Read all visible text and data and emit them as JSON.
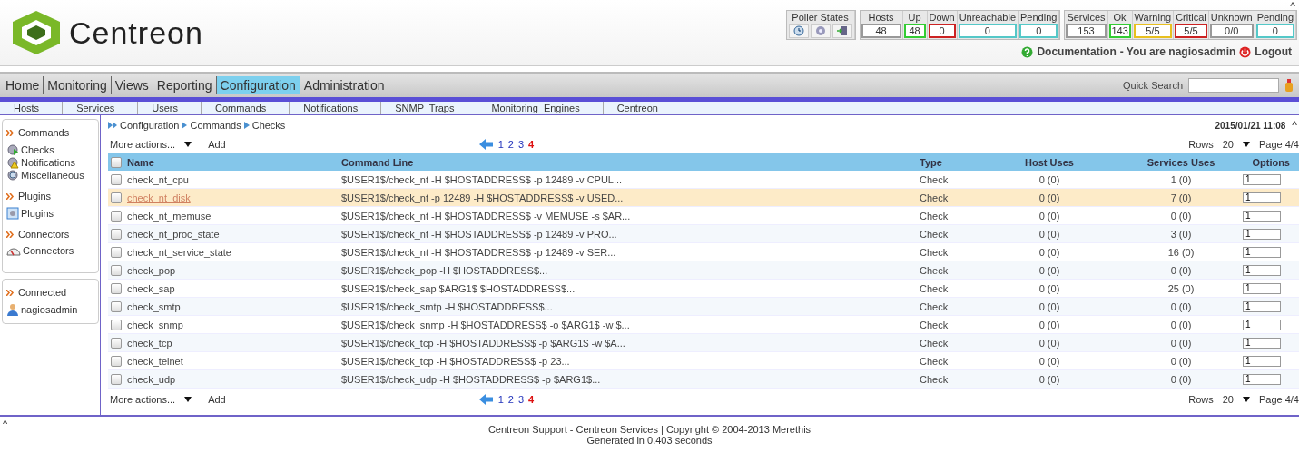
{
  "logo": {
    "text": "Centreon"
  },
  "header_caret": "^",
  "poller": {
    "title": "Poller States"
  },
  "hosts_stats": [
    {
      "label": "Hosts",
      "value": "48",
      "color": "#999999"
    },
    {
      "label": "Up",
      "value": "48",
      "color": "#33cc33"
    },
    {
      "label": "Down",
      "value": "0",
      "color": "#cc2222"
    },
    {
      "label": "Unreachable",
      "value": "0",
      "color": "#55c8c8"
    },
    {
      "label": "Pending",
      "value": "0",
      "color": "#55c8c8"
    }
  ],
  "services_stats": [
    {
      "label": "Services",
      "value": "153",
      "color": "#999999"
    },
    {
      "label": "Ok",
      "value": "143",
      "color": "#33cc33"
    },
    {
      "label": "Warning",
      "value": "5/5",
      "color": "#e8c020"
    },
    {
      "label": "Critical",
      "value": "5/5",
      "color": "#cc2222"
    },
    {
      "label": "Unknown",
      "value": "0/0",
      "color": "#999999"
    },
    {
      "label": "Pending",
      "value": "0",
      "color": "#55c8c8"
    }
  ],
  "user_bar": {
    "documentation": "Documentation",
    "user_text": "- You are nagiosadmin",
    "logout": "Logout"
  },
  "menu": [
    {
      "label": "Home",
      "selected": false
    },
    {
      "label": "Monitoring",
      "selected": false
    },
    {
      "label": "Views",
      "selected": false
    },
    {
      "label": "Reporting",
      "selected": false
    },
    {
      "label": "Configuration",
      "selected": true
    },
    {
      "label": "Administration",
      "selected": false
    }
  ],
  "quick_search": {
    "label": "Quick Search"
  },
  "submenu": [
    "Hosts",
    "Services",
    "Users",
    "Commands",
    "Notifications",
    "SNMP  Traps",
    "Monitoring  Engines",
    "Centreon"
  ],
  "sidebar": [
    {
      "title": "Commands",
      "items": [
        {
          "label": "Checks",
          "kind": "checks"
        },
        {
          "label": "Notifications",
          "kind": "notifications"
        },
        {
          "label": "Miscellaneous",
          "kind": "misc"
        }
      ]
    },
    {
      "title": "Plugins",
      "items": [
        {
          "label": "Plugins",
          "kind": "plugins"
        }
      ]
    },
    {
      "title": "Connectors",
      "items": [
        {
          "label": "Connectors",
          "kind": "connectors"
        }
      ]
    }
  ],
  "connected": {
    "title": "Connected",
    "user": "nagiosadmin"
  },
  "breadcrumb": [
    "Configuration",
    "Commands",
    "Checks"
  ],
  "datetime": "2015/01/21 11:08",
  "content_caret": "^",
  "toolbars": [
    {
      "more_actions": "More actions...",
      "add": "Add",
      "pages": [
        {
          "label": "1",
          "selected": false
        },
        {
          "label": "2",
          "selected": false
        },
        {
          "label": "3",
          "selected": false
        },
        {
          "label": "4",
          "selected": true
        }
      ],
      "rows_label": "Rows",
      "rows_value": "20",
      "page_info": "Page 4/4"
    },
    {
      "more_actions": "More actions...",
      "add": "Add",
      "pages": [
        {
          "label": "1",
          "selected": false
        },
        {
          "label": "2",
          "selected": false
        },
        {
          "label": "3",
          "selected": false
        },
        {
          "label": "4",
          "selected": true
        }
      ],
      "rows_label": "Rows",
      "rows_value": "20",
      "page_info": "Page 4/4"
    }
  ],
  "table": {
    "all_checked": false,
    "columns": [
      "Name",
      "Command Line",
      "Type",
      "Host Uses",
      "Services Uses",
      "Options"
    ],
    "rows": [
      {
        "name": "check_nt_cpu",
        "command": "$USER1$/check_nt -H $HOSTADDRESS$ -p 12489 -v CPUL...",
        "type": "Check",
        "host_uses": "0 (0)",
        "service_uses": "1 (0)",
        "option": "1",
        "hovered": false
      },
      {
        "name": "check_nt_disk",
        "command": "$USER1$/check_nt -p 12489 -H $HOSTADDRESS$ -v USED...",
        "type": "Check",
        "host_uses": "0 (0)",
        "service_uses": "7 (0)",
        "option": "1",
        "hovered": true
      },
      {
        "name": "check_nt_memuse",
        "command": "$USER1$/check_nt -H $HOSTADDRESS$ -v MEMUSE -s $AR...",
        "type": "Check",
        "host_uses": "0 (0)",
        "service_uses": "0 (0)",
        "option": "1",
        "hovered": false
      },
      {
        "name": "check_nt_proc_state",
        "command": "$USER1$/check_nt -H $HOSTADDRESS$ -p 12489 -v PRO...",
        "type": "Check",
        "host_uses": "0 (0)",
        "service_uses": "3 (0)",
        "option": "1",
        "hovered": false
      },
      {
        "name": "check_nt_service_state",
        "command": "$USER1$/check_nt -H $HOSTADDRESS$ -p 12489 -v SER...",
        "type": "Check",
        "host_uses": "0 (0)",
        "service_uses": "16 (0)",
        "option": "1",
        "hovered": false
      },
      {
        "name": "check_pop",
        "command": "$USER1$/check_pop -H $HOSTADDRESS$...",
        "type": "Check",
        "host_uses": "0 (0)",
        "service_uses": "0 (0)",
        "option": "1",
        "hovered": false
      },
      {
        "name": "check_sap",
        "command": "$USER1$/check_sap $ARG1$ $HOSTADDRESS$...",
        "type": "Check",
        "host_uses": "0 (0)",
        "service_uses": "25 (0)",
        "option": "1",
        "hovered": false
      },
      {
        "name": "check_smtp",
        "command": "$USER1$/check_smtp -H $HOSTADDRESS$...",
        "type": "Check",
        "host_uses": "0 (0)",
        "service_uses": "0 (0)",
        "option": "1",
        "hovered": false
      },
      {
        "name": "check_snmp",
        "command": "$USER1$/check_snmp -H $HOSTADDRESS$ -o $ARG1$ -w $...",
        "type": "Check",
        "host_uses": "0 (0)",
        "service_uses": "0 (0)",
        "option": "1",
        "hovered": false
      },
      {
        "name": "check_tcp",
        "command": "$USER1$/check_tcp -H $HOSTADDRESS$ -p $ARG1$ -w $A...",
        "type": "Check",
        "host_uses": "0 (0)",
        "service_uses": "0 (0)",
        "option": "1",
        "hovered": false
      },
      {
        "name": "check_telnet",
        "command": "$USER1$/check_tcp -H $HOSTADDRESS$ -p 23...",
        "type": "Check",
        "host_uses": "0 (0)",
        "service_uses": "0 (0)",
        "option": "1",
        "hovered": false
      },
      {
        "name": "check_udp",
        "command": "$USER1$/check_udp -H $HOSTADDRESS$ -p $ARG1$...",
        "type": "Check",
        "host_uses": "0 (0)",
        "service_uses": "0 (0)",
        "option": "1",
        "hovered": false
      }
    ]
  },
  "footer": {
    "caret": "^",
    "line1": "Centreon Support - Centreon Services | Copyright © 2004-2013 Merethis",
    "line2": "Generated in 0.403 seconds"
  }
}
